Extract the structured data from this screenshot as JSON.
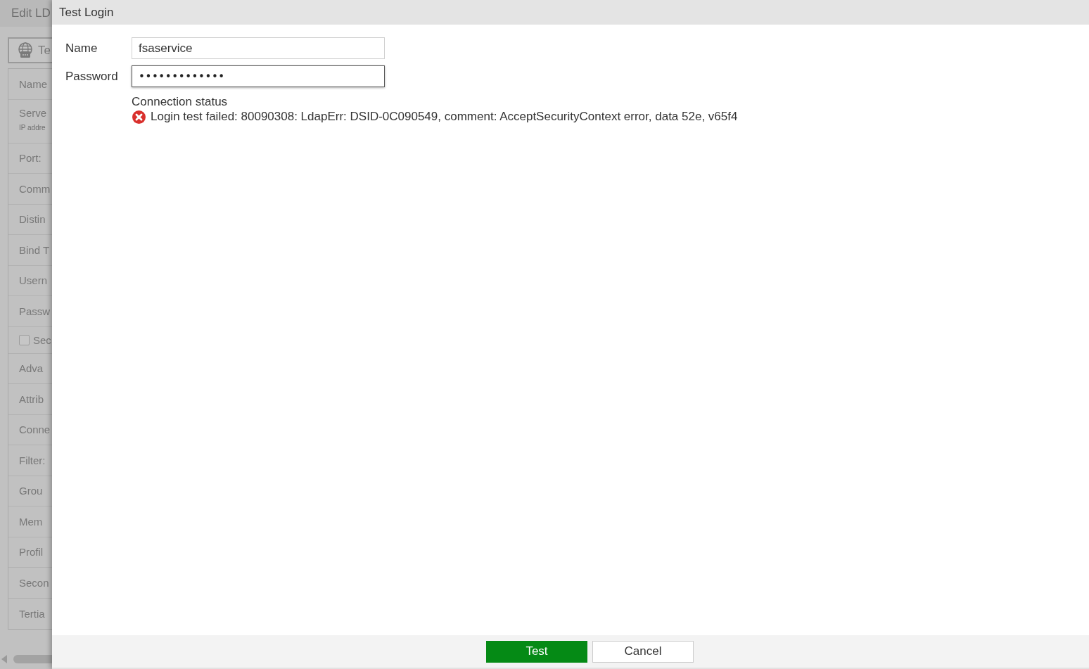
{
  "background_page": {
    "title": "Edit LD",
    "toolbar_button": {
      "label": "Te"
    },
    "form_rows": [
      {
        "kind": "field",
        "label": "Name"
      },
      {
        "kind": "field",
        "label": "Serve",
        "hint": "IP addre"
      },
      {
        "kind": "field",
        "label": "Port:"
      },
      {
        "kind": "field",
        "label": "Comm"
      },
      {
        "kind": "field",
        "label": "Distin"
      },
      {
        "kind": "field",
        "label": "Bind T"
      },
      {
        "kind": "field",
        "label": "Usern"
      },
      {
        "kind": "field",
        "label": "Passw"
      },
      {
        "kind": "checkbox",
        "label": "Sec",
        "checked": false
      },
      {
        "kind": "field",
        "label": "Adva"
      },
      {
        "kind": "field",
        "label": "Attrib"
      },
      {
        "kind": "field",
        "label": "Conne"
      },
      {
        "kind": "field",
        "label": "Filter:"
      },
      {
        "kind": "field",
        "label": "Grou"
      },
      {
        "kind": "field",
        "label": "Mem"
      },
      {
        "kind": "field",
        "label": "Profil"
      },
      {
        "kind": "field",
        "label": "Secon"
      },
      {
        "kind": "field",
        "label": "Tertia"
      }
    ]
  },
  "dialog": {
    "title": "Test Login",
    "fields": [
      {
        "kind": "text",
        "label": "Name",
        "value": "fsaservice",
        "focused": false
      },
      {
        "kind": "password",
        "label": "Password",
        "value": "•••••••••••••",
        "focused": true
      }
    ],
    "connection_status": {
      "label": "Connection status",
      "kind": "error",
      "message": "Login test failed: 80090308: LdapErr: DSID-0C090549, comment: AcceptSecurityContext error, data 52e, v65f4"
    },
    "buttons": [
      {
        "label": "Test",
        "kind": "primary"
      },
      {
        "label": "Cancel",
        "kind": "secondary"
      }
    ]
  }
}
